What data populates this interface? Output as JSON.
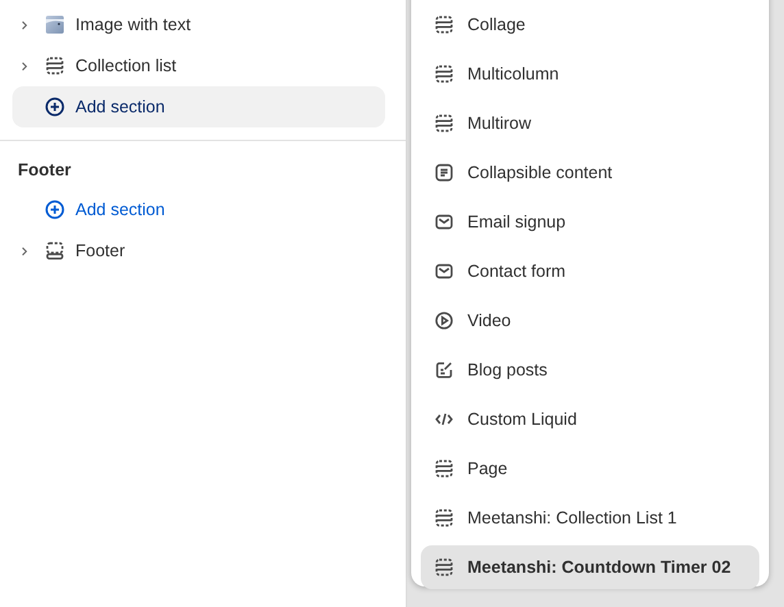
{
  "sidebar": {
    "items": [
      {
        "label": "Image with text"
      },
      {
        "kind": "section",
        "label": "Collection list"
      },
      {
        "kind": "add",
        "label": "Add section",
        "highlighted": true
      }
    ],
    "groups": [
      {
        "title": "Footer",
        "items": [
          {
            "kind": "add",
            "label": "Add section",
            "highlighted": false
          },
          {
            "kind": "footer",
            "label": "Footer"
          }
        ]
      }
    ]
  },
  "menu": {
    "items": [
      {
        "kind": "section",
        "label": "Collage",
        "selected": false
      },
      {
        "kind": "section",
        "label": "Multicolumn",
        "selected": false
      },
      {
        "kind": "section",
        "label": "Multirow",
        "selected": false
      },
      {
        "kind": "collapsible",
        "label": "Collapsible content",
        "selected": false
      },
      {
        "kind": "mail",
        "label": "Email signup",
        "selected": false
      },
      {
        "kind": "mail",
        "label": "Contact form",
        "selected": false
      },
      {
        "kind": "video",
        "label": "Video",
        "selected": false
      },
      {
        "kind": "blog",
        "label": "Blog posts",
        "selected": false
      },
      {
        "kind": "code",
        "label": "Custom Liquid",
        "selected": false
      },
      {
        "kind": "section",
        "label": "Page",
        "selected": false
      },
      {
        "kind": "section",
        "label": "Meetanshi: Collection List 1",
        "selected": false
      },
      {
        "kind": "section",
        "label": "Meetanshi: Countdown Timer 02",
        "selected": true
      }
    ]
  }
}
